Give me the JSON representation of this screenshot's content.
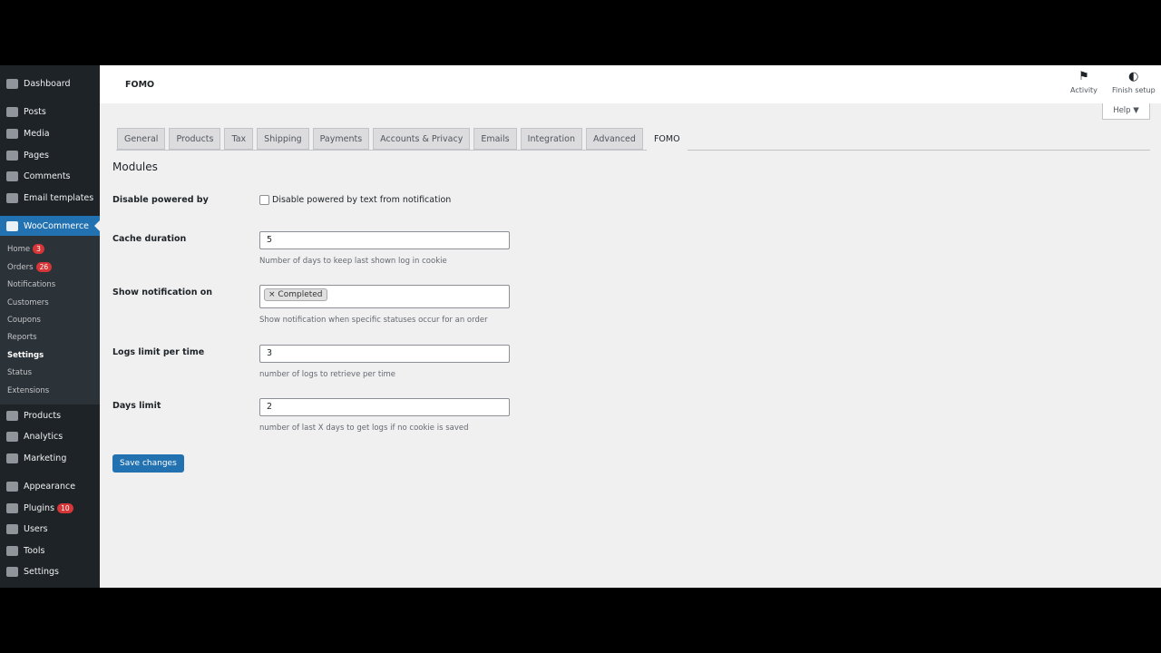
{
  "sidebar": {
    "items": [
      {
        "label": "Dashboard",
        "icon": "dashboard-icon"
      },
      {
        "label": "Posts",
        "icon": "pin-icon"
      },
      {
        "label": "Media",
        "icon": "media-icon"
      },
      {
        "label": "Pages",
        "icon": "pages-icon"
      },
      {
        "label": "Comments",
        "icon": "comment-icon"
      },
      {
        "label": "Email templates",
        "icon": "mail-icon"
      },
      {
        "label": "WooCommerce",
        "icon": "woo-icon"
      }
    ],
    "submenu": [
      {
        "label": "Home",
        "badge": "3"
      },
      {
        "label": "Orders",
        "badge": "26"
      },
      {
        "label": "Notifications"
      },
      {
        "label": "Customers"
      },
      {
        "label": "Coupons"
      },
      {
        "label": "Reports"
      },
      {
        "label": "Settings"
      },
      {
        "label": "Status"
      },
      {
        "label": "Extensions"
      }
    ],
    "items2": [
      {
        "label": "Products"
      },
      {
        "label": "Analytics"
      },
      {
        "label": "Marketing"
      },
      {
        "label": "Appearance"
      },
      {
        "label": "Plugins",
        "badge": "10"
      },
      {
        "label": "Users"
      },
      {
        "label": "Tools"
      },
      {
        "label": "Settings"
      }
    ]
  },
  "header": {
    "title": "FOMO",
    "activity": "Activity",
    "finish_setup": "Finish setup",
    "help": "Help ▼"
  },
  "tabs": [
    "General",
    "Products",
    "Tax",
    "Shipping",
    "Payments",
    "Accounts & Privacy",
    "Emails",
    "Integration",
    "Advanced",
    "FOMO"
  ],
  "section_title": "Modules",
  "fields": {
    "powered": {
      "label": "Disable powered by",
      "checkbox_label": "Disable powered by text from notification",
      "checked": false
    },
    "cache": {
      "label": "Cache duration",
      "value": "5",
      "desc": "Number of days to keep last shown log in cookie"
    },
    "show_on": {
      "label": "Show notification on",
      "chip": "Completed",
      "chip_remove": "×",
      "desc": "Show notification when specific statuses occur for an order"
    },
    "logs": {
      "label": "Logs limit per time",
      "value": "3",
      "desc": "number of logs to retrieve per time"
    },
    "days": {
      "label": "Days limit",
      "value": "2",
      "desc": "number of last X days to get logs if no cookie is saved"
    }
  },
  "save_label": "Save changes",
  "colors": {
    "accent": "#2271b1",
    "sidebar": "#1d2327",
    "badge": "#d63638"
  }
}
